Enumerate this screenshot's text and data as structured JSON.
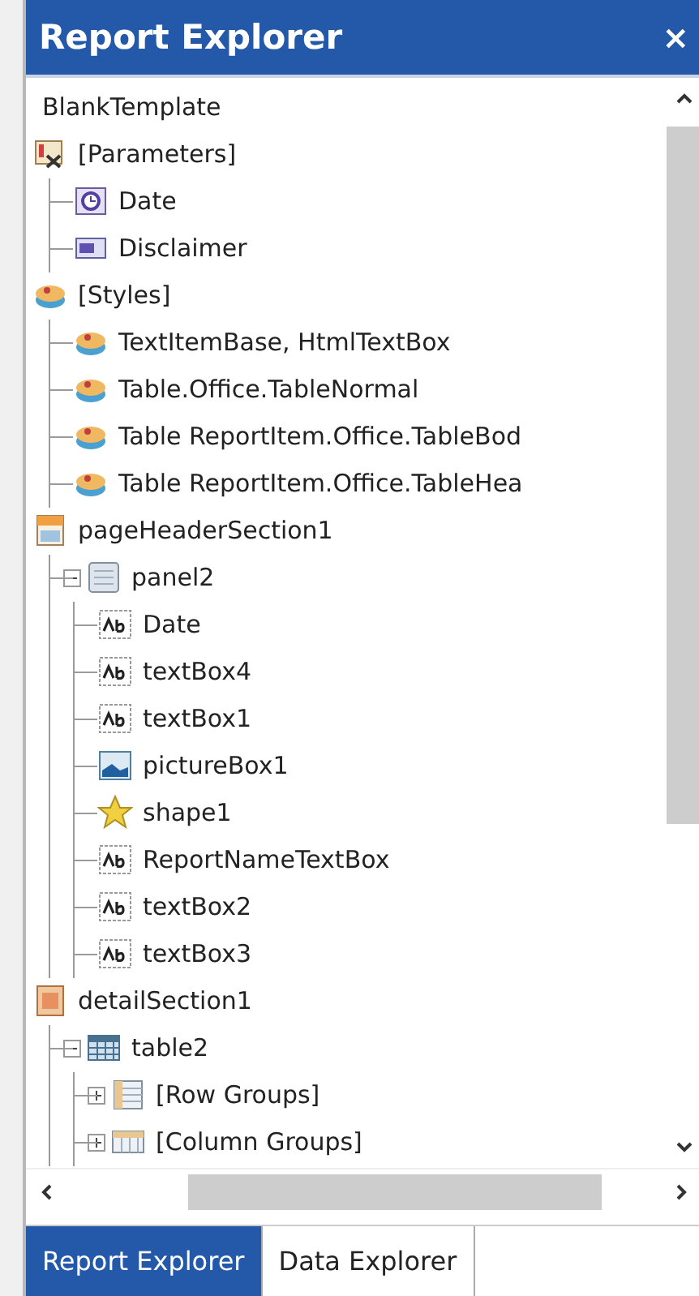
{
  "window": {
    "title": "Report Explorer",
    "close": "×"
  },
  "tree": [
    {
      "label": "BlankTemplate",
      "kind": "root"
    },
    {
      "label": "[Parameters]",
      "kind": "parameters",
      "children": [
        {
          "label": "Date",
          "kind": "datetime"
        },
        {
          "label": "Disclaimer",
          "kind": "text-param"
        }
      ]
    },
    {
      "label": "[Styles]",
      "kind": "styles",
      "children": [
        {
          "label": "TextItemBase, HtmlTextBox",
          "kind": "style"
        },
        {
          "label": "Table.Office.TableNormal",
          "kind": "style"
        },
        {
          "label": "Table ReportItem.Office.TableBod",
          "kind": "style"
        },
        {
          "label": "Table ReportItem.Office.TableHea",
          "kind": "style"
        }
      ]
    },
    {
      "label": "pageHeaderSection1",
      "kind": "section-header",
      "children": [
        {
          "label": "panel2",
          "kind": "panel",
          "expanded": true,
          "children": [
            {
              "label": "Date",
              "kind": "textbox"
            },
            {
              "label": "textBox4",
              "kind": "textbox"
            },
            {
              "label": "textBox1",
              "kind": "textbox"
            },
            {
              "label": "pictureBox1",
              "kind": "picturebox"
            },
            {
              "label": "shape1",
              "kind": "shape"
            },
            {
              "label": "ReportNameTextBox",
              "kind": "textbox"
            },
            {
              "label": "textBox2",
              "kind": "textbox"
            },
            {
              "label": "textBox3",
              "kind": "textbox"
            }
          ]
        }
      ]
    },
    {
      "label": "detailSection1",
      "kind": "section-detail",
      "children": [
        {
          "label": "table2",
          "kind": "table",
          "expanded": true,
          "children": [
            {
              "label": "[Row Groups]",
              "kind": "row-groups",
              "expanded": false
            },
            {
              "label": "[Column Groups]",
              "kind": "column-groups",
              "expanded": false
            }
          ]
        }
      ]
    }
  ],
  "tabs": [
    {
      "label": "Report Explorer",
      "selected": true
    },
    {
      "label": "Data Explorer",
      "selected": false
    }
  ]
}
